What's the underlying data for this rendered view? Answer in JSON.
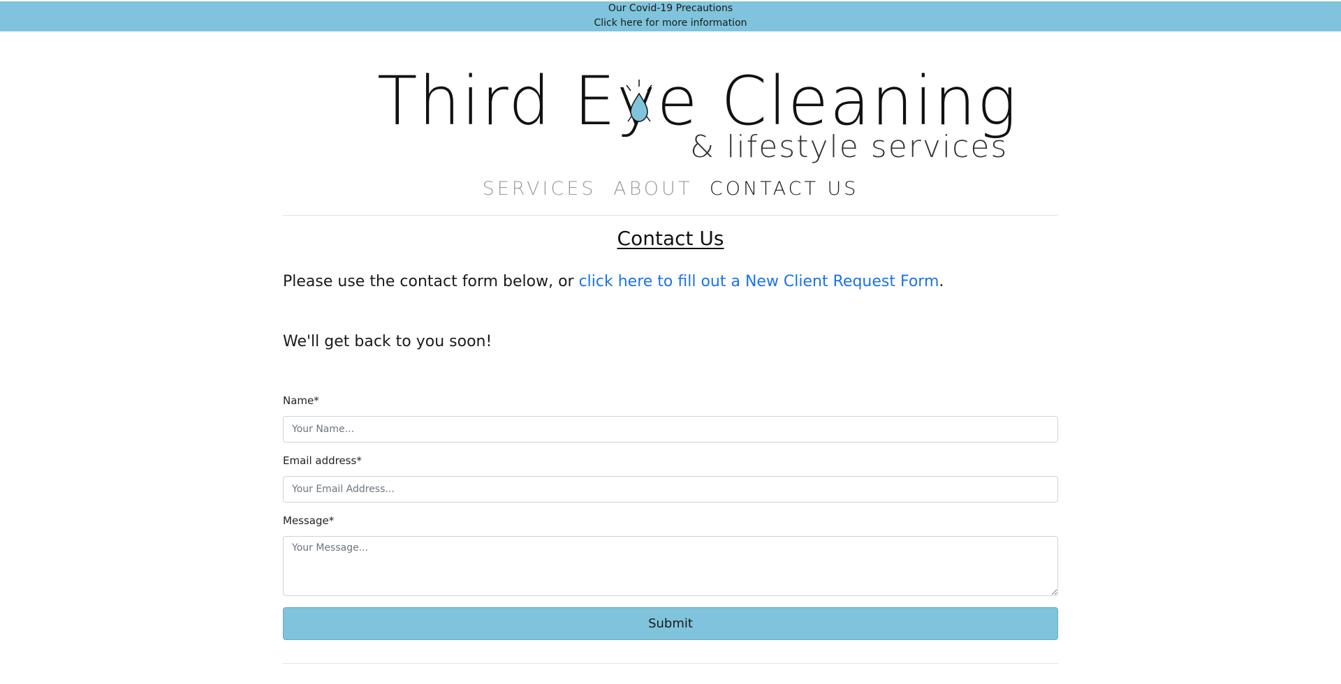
{
  "banner": {
    "title": "Our Covid-19 Precautions",
    "link": "Click here for more information",
    "bg_color": "#7fc4dc"
  },
  "logo": {
    "main_text": "Third Eye Cleaning",
    "sub_text": "& lifestyle services",
    "drop_color": "#7fc4dc"
  },
  "nav": {
    "items": [
      {
        "label": "SERVICES"
      },
      {
        "label": "ABOUT"
      },
      {
        "label": "CONTACT US"
      }
    ]
  },
  "main": {
    "title": "Contact Us",
    "intro_text": "Please use the contact form below, or ",
    "intro_link": "click here to fill out a New Client Request Form",
    "intro_end": ".",
    "soon_text": "We'll get back to you soon!",
    "link_color": "#1a73e8"
  },
  "form": {
    "name_label": "Name*",
    "name_placeholder": "Your Name...",
    "email_label": "Email address*",
    "email_placeholder": "Your Email Address...",
    "message_label": "Message*",
    "message_placeholder": "Your Message...",
    "submit_label": "Submit",
    "submit_color": "#7fc4dc"
  }
}
